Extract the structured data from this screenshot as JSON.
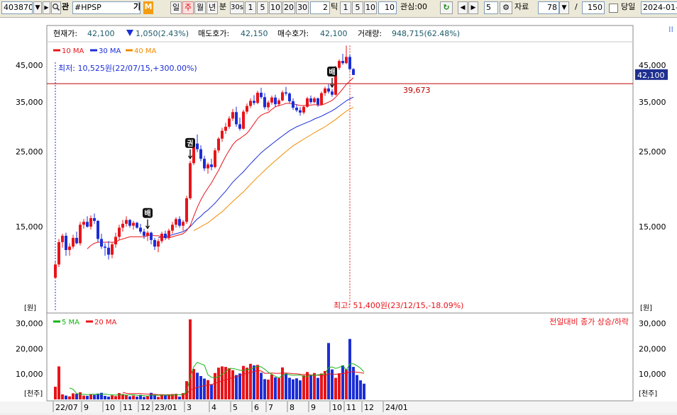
{
  "toolbar": {
    "code": "403870",
    "name_label": "#HPSP",
    "ki": "기",
    "m": "M",
    "q_icon": "magnifier-icon",
    "gwan": "관",
    "periods": [
      "일",
      "주",
      "월",
      "년"
    ],
    "active_period": "주",
    "bun": "분",
    "sec30": "30s",
    "minute_buttons": [
      "1",
      "5",
      "10",
      "20",
      "30"
    ],
    "tick_value": "2",
    "tick_label": "틱",
    "tick_buttons": [
      "1",
      "5",
      "10"
    ],
    "tick_input": "10",
    "gwansim": "관심:00",
    "step_value": "5",
    "jaryo": "자료",
    "data_count": "78",
    "slash": "/",
    "total_count": "150",
    "dangil": "당일",
    "date": "2024-01-"
  },
  "info": {
    "current_label": "현재가:",
    "current": "42,100",
    "change": "1,050(2.43%)",
    "ask_label": "매도호가:",
    "ask": "42,150",
    "bid_label": "매수호가:",
    "bid": "42,100",
    "volume_label": "거래량:",
    "volume": "948,715(62.48%)"
  },
  "legend": {
    "ma10": "10 MA",
    "ma30": "30 MA",
    "ma40": "40 MA",
    "vma5": "5 MA",
    "vma20": "20 MA",
    "vol_caption": "전일대비 종가 상승/하락"
  },
  "colors": {
    "up": "#e8141a",
    "down": "#1c2ed6",
    "ma10": "#e8141a",
    "ma30": "#1c2ed6",
    "ma40": "#f08c00",
    "vma5": "#14b414",
    "vma20": "#e8141a",
    "hline": "#c00000"
  },
  "chart_data": [
    {
      "type": "candlestick",
      "price_axis_ticks": [
        "45,000",
        "35,000",
        "25,000",
        "15,000"
      ],
      "price_unit": "[원]",
      "ylim": [
        8500,
        51000
      ],
      "current_price_tag": "42,100",
      "hline_value": 39673,
      "hline_label": "39,673",
      "low_annotation": "최저: 10,525원(22/07/15,+300.00%)",
      "high_annotation": "최고: 51,400원(23/12/15,-18.09%)",
      "markers": [
        {
          "index": 26,
          "text": "배"
        },
        {
          "index": 38,
          "text": "권"
        },
        {
          "index": 78,
          "text": "배"
        }
      ],
      "x_labels": [
        "22/07",
        "9",
        "10",
        "11",
        "12",
        "23/01",
        "3",
        "4",
        "5",
        "6",
        "7",
        "8",
        "9",
        "10",
        "11",
        "12",
        "24/01"
      ],
      "x_label_index": [
        0,
        8,
        14,
        19,
        24,
        28,
        37,
        44,
        50,
        56,
        60,
        66,
        72,
        78,
        82,
        87,
        93
      ],
      "candles": [
        [
          10600,
          11800,
          10500,
          11600
        ],
        [
          11600,
          13800,
          11400,
          13500
        ],
        [
          13500,
          14300,
          13000,
          14100
        ],
        [
          14100,
          14400,
          12300,
          12800
        ],
        [
          12800,
          13400,
          12300,
          13100
        ],
        [
          13100,
          14200,
          12900,
          13900
        ],
        [
          13900,
          14500,
          13300,
          13400
        ],
        [
          13400,
          15500,
          13200,
          15200
        ],
        [
          15200,
          15800,
          14800,
          15500
        ],
        [
          15500,
          16100,
          14900,
          15000
        ],
        [
          15000,
          16200,
          14700,
          15900
        ],
        [
          15900,
          16400,
          15300,
          15600
        ],
        [
          15600,
          15700,
          13500,
          13800
        ],
        [
          13800,
          14300,
          12900,
          13100
        ],
        [
          13100,
          13400,
          12300,
          13000
        ],
        [
          13000,
          13600,
          12000,
          12400
        ],
        [
          12400,
          13500,
          12100,
          13300
        ],
        [
          13300,
          14400,
          13000,
          14000
        ],
        [
          14000,
          15200,
          13700,
          14900
        ],
        [
          14900,
          15700,
          14500,
          15300
        ],
        [
          15300,
          16100,
          15000,
          15700
        ],
        [
          15700,
          15800,
          14900,
          15100
        ],
        [
          15100,
          15600,
          14700,
          15400
        ],
        [
          15400,
          15500,
          14800,
          14900
        ],
        [
          14900,
          15300,
          14300,
          14500
        ],
        [
          14500,
          14800,
          13800,
          14100
        ],
        [
          14100,
          14600,
          13600,
          14400
        ],
        [
          14400,
          14500,
          13300,
          13700
        ],
        [
          13700,
          13900,
          12800,
          13100
        ],
        [
          13100,
          13800,
          12600,
          13600
        ],
        [
          13600,
          14500,
          13400,
          14300
        ],
        [
          14300,
          14600,
          13700,
          13900
        ],
        [
          13900,
          14800,
          13700,
          14600
        ],
        [
          14600,
          15500,
          14300,
          15200
        ],
        [
          15200,
          16000,
          14900,
          15800
        ],
        [
          15800,
          16100,
          14900,
          15100
        ],
        [
          15100,
          15700,
          14600,
          15500
        ],
        [
          15500,
          18500,
          15300,
          18200
        ],
        [
          18200,
          23500,
          18000,
          23100
        ],
        [
          23100,
          27000,
          22800,
          26400
        ],
        [
          26400,
          28100,
          24900,
          25400
        ],
        [
          25400,
          26100,
          23400,
          23800
        ],
        [
          23800,
          24300,
          21900,
          22300
        ],
        [
          22300,
          23200,
          21500,
          22900
        ],
        [
          22900,
          23800,
          22000,
          22500
        ],
        [
          22500,
          25600,
          22300,
          25200
        ],
        [
          25200,
          27600,
          24800,
          27300
        ],
        [
          27300,
          29400,
          26700,
          28800
        ],
        [
          28800,
          30400,
          28200,
          29600
        ],
        [
          29600,
          31800,
          29200,
          31300
        ],
        [
          31300,
          33400,
          30800,
          32700
        ],
        [
          32700,
          33900,
          29600,
          30100
        ],
        [
          30100,
          31500,
          28800,
          29200
        ],
        [
          29200,
          33200,
          29000,
          32800
        ],
        [
          32800,
          34700,
          32300,
          34100
        ],
        [
          34100,
          35900,
          33600,
          35300
        ],
        [
          35300,
          36700,
          34300,
          34800
        ],
        [
          34800,
          37800,
          34500,
          37300
        ],
        [
          37300,
          38600,
          35800,
          36200
        ],
        [
          36200,
          37200,
          33300,
          33800
        ],
        [
          33800,
          35400,
          33000,
          34900
        ],
        [
          34900,
          36600,
          34400,
          36100
        ],
        [
          36100,
          36800,
          33900,
          34500
        ],
        [
          34500,
          35900,
          34000,
          35400
        ],
        [
          35400,
          37900,
          35200,
          37400
        ],
        [
          37400,
          38800,
          36600,
          37100
        ],
        [
          37100,
          37400,
          34800,
          35200
        ],
        [
          35200,
          35900,
          33200,
          33700
        ],
        [
          33700,
          34500,
          32700,
          33100
        ],
        [
          33100,
          33800,
          31900,
          32600
        ],
        [
          32600,
          34200,
          32200,
          33900
        ],
        [
          33900,
          36300,
          33700,
          35900
        ],
        [
          35900,
          36600,
          34600,
          35000
        ],
        [
          35000,
          36300,
          34700,
          35900
        ],
        [
          35900,
          36100,
          33900,
          34400
        ],
        [
          34400,
          37600,
          34200,
          37200
        ],
        [
          37200,
          38900,
          36500,
          38400
        ],
        [
          38400,
          39500,
          37100,
          37600
        ],
        [
          37600,
          38200,
          36300,
          36800
        ],
        [
          36800,
          44800,
          36600,
          44200
        ],
        [
          44200,
          46800,
          43600,
          46300
        ],
        [
          46300,
          48600,
          45100,
          45600
        ],
        [
          45600,
          51400,
          45300,
          47600
        ],
        [
          47600,
          48400,
          43400,
          43800
        ],
        [
          43800,
          44100,
          42100,
          42100
        ]
      ],
      "ma10": [
        null,
        null,
        null,
        null,
        null,
        null,
        null,
        null,
        null,
        12900,
        13200,
        13400,
        13500,
        13500,
        13500,
        13500,
        13500,
        13500,
        13700,
        13800,
        13900,
        14000,
        14000,
        14000,
        14000,
        14000,
        14100,
        14200,
        14100,
        14100,
        14000,
        13900,
        13900,
        14000,
        14100,
        14200,
        14300,
        14600,
        15100,
        16100,
        17100,
        18000,
        18800,
        19500,
        20200,
        21100,
        22000,
        23100,
        24200,
        25200,
        26200,
        26900,
        27300,
        27800,
        28300,
        29200,
        30200,
        31300,
        32000,
        32400,
        32600,
        33300,
        33900,
        34200,
        34400,
        34700,
        34700,
        34600,
        34400,
        34200,
        34200,
        34300,
        34300,
        34400,
        34300,
        34300,
        34600,
        35000,
        35400,
        36200,
        37200,
        38300,
        39500,
        40400,
        41300
      ],
      "ma30": [
        null,
        null,
        null,
        null,
        null,
        null,
        null,
        null,
        null,
        null,
        null,
        null,
        null,
        null,
        null,
        null,
        null,
        null,
        null,
        null,
        null,
        null,
        null,
        null,
        null,
        null,
        null,
        null,
        null,
        13900,
        14000,
        14000,
        14100,
        14200,
        14300,
        14400,
        14500,
        14700,
        15000,
        15400,
        15800,
        16100,
        16500,
        16800,
        17200,
        17600,
        18100,
        18600,
        19100,
        19700,
        20300,
        20800,
        21300,
        21800,
        22400,
        23000,
        23600,
        24200,
        24800,
        25300,
        25800,
        26300,
        26800,
        27300,
        27800,
        28300,
        28800,
        29200,
        29600,
        29900,
        30200,
        30500,
        30800,
        31200,
        31500,
        31800,
        32200,
        32600,
        33000,
        33500,
        34100,
        34700,
        35300,
        35800,
        36200
      ],
      "ma40": [
        null,
        null,
        null,
        null,
        null,
        null,
        null,
        null,
        null,
        null,
        null,
        null,
        null,
        null,
        null,
        null,
        null,
        null,
        null,
        null,
        null,
        null,
        null,
        null,
        null,
        null,
        null,
        null,
        null,
        null,
        null,
        null,
        null,
        null,
        null,
        null,
        null,
        null,
        null,
        14600,
        14800,
        15000,
        15200,
        15400,
        15700,
        16000,
        16300,
        16600,
        17000,
        17400,
        17800,
        18200,
        18600,
        19000,
        19500,
        20000,
        20500,
        21000,
        21500,
        22000,
        22500,
        23000,
        23500,
        24000,
        24500,
        25000,
        25500,
        26000,
        26400,
        26800,
        27200,
        27600,
        28000,
        28400,
        28800,
        29200,
        29600,
        30100,
        30600,
        31100,
        31700,
        32300,
        32900,
        33400,
        33800
      ]
    },
    {
      "type": "bar",
      "title": "volume",
      "unit_label": "[천주]",
      "axis_ticks": [
        "30,000",
        "20,000",
        "10,000"
      ],
      "ylim": [
        0,
        31500
      ],
      "values": [
        5000,
        13000,
        2000,
        1500,
        1200,
        2400,
        2200,
        2800,
        1500,
        1400,
        2000,
        1800,
        2300,
        2600,
        1400,
        1100,
        1600,
        1300,
        2500,
        2100,
        1700,
        1200,
        1500,
        1100,
        1800,
        1000,
        1300,
        2600,
        1700,
        1000,
        1800,
        1600,
        2000,
        2100,
        2200,
        1100,
        2500,
        7200,
        31500,
        12000,
        10500,
        9200,
        8200,
        7600,
        5800,
        10400,
        12500,
        13000,
        12800,
        12300,
        11500,
        9600,
        10200,
        13200,
        12500,
        14000,
        13400,
        13600,
        10500,
        8000,
        7800,
        9800,
        8700,
        8400,
        12600,
        10200,
        8500,
        7900,
        8300,
        7500,
        9500,
        10800,
        9400,
        10400,
        8500,
        10200,
        11200,
        22200,
        11800,
        8500,
        10300,
        13400,
        11900,
        23800,
        12800,
        9600,
        7500,
        6200
      ],
      "up_flags": [
        1,
        1,
        1,
        0,
        1,
        1,
        0,
        1,
        1,
        0,
        1,
        0,
        0,
        0,
        0,
        0,
        1,
        1,
        1,
        1,
        1,
        0,
        1,
        0,
        0,
        0,
        1,
        0,
        0,
        1,
        1,
        0,
        1,
        1,
        1,
        0,
        1,
        1,
        1,
        1,
        0,
        0,
        0,
        1,
        0,
        1,
        1,
        1,
        1,
        1,
        1,
        0,
        0,
        1,
        1,
        1,
        0,
        1,
        0,
        0,
        1,
        1,
        0,
        1,
        1,
        0,
        0,
        0,
        0,
        0,
        1,
        1,
        0,
        1,
        0,
        1,
        1,
        0,
        0,
        1,
        1,
        0,
        1,
        0,
        0,
        0,
        0,
        0
      ],
      "vma5": [
        null,
        null,
        null,
        null,
        4500,
        4000,
        2300,
        2000,
        2000,
        1900,
        2000,
        2000,
        2000,
        2100,
        2100,
        1900,
        1800,
        1700,
        1900,
        1800,
        1700,
        1800,
        1800,
        1600,
        1600,
        1500,
        1300,
        1700,
        1700,
        1600,
        1700,
        1700,
        1600,
        1700,
        1800,
        1800,
        2000,
        3000,
        8700,
        12800,
        14600,
        14000,
        13500,
        9700,
        8700,
        8500,
        8900,
        9800,
        10900,
        12200,
        12200,
        11900,
        11500,
        11400,
        11800,
        11900,
        12600,
        13100,
        12800,
        11900,
        10700,
        9900,
        9100,
        8500,
        9400,
        10100,
        9700,
        9500,
        9600,
        9600,
        8900,
        9100,
        9500,
        9500,
        9700,
        9900,
        10000,
        12500,
        12800,
        12200,
        12600,
        13300,
        11600,
        14000,
        14000,
        13300,
        12300,
        10800
      ],
      "vma20": [
        null,
        null,
        null,
        null,
        null,
        null,
        null,
        null,
        null,
        null,
        null,
        null,
        null,
        null,
        null,
        null,
        null,
        null,
        null,
        2800,
        2400,
        2300,
        2300,
        2300,
        2300,
        2200,
        2100,
        2100,
        2000,
        1900,
        1900,
        1800,
        1800,
        1800,
        1800,
        1800,
        1900,
        2200,
        3700,
        4200,
        4700,
        5100,
        5400,
        5700,
        5900,
        6300,
        6800,
        7300,
        7700,
        8100,
        8600,
        9000,
        9400,
        9900,
        10300,
        10600,
        11000,
        11300,
        11200,
        10300,
        10300,
        10400,
        10300,
        10300,
        10400,
        10400,
        10300,
        10100,
        10100,
        9900,
        9800,
        9800,
        9700,
        9600,
        9500,
        9400,
        9400,
        10000,
        10000,
        9900,
        10000,
        10200,
        10400,
        10800,
        10900,
        10700,
        10500,
        10300
      ]
    }
  ]
}
